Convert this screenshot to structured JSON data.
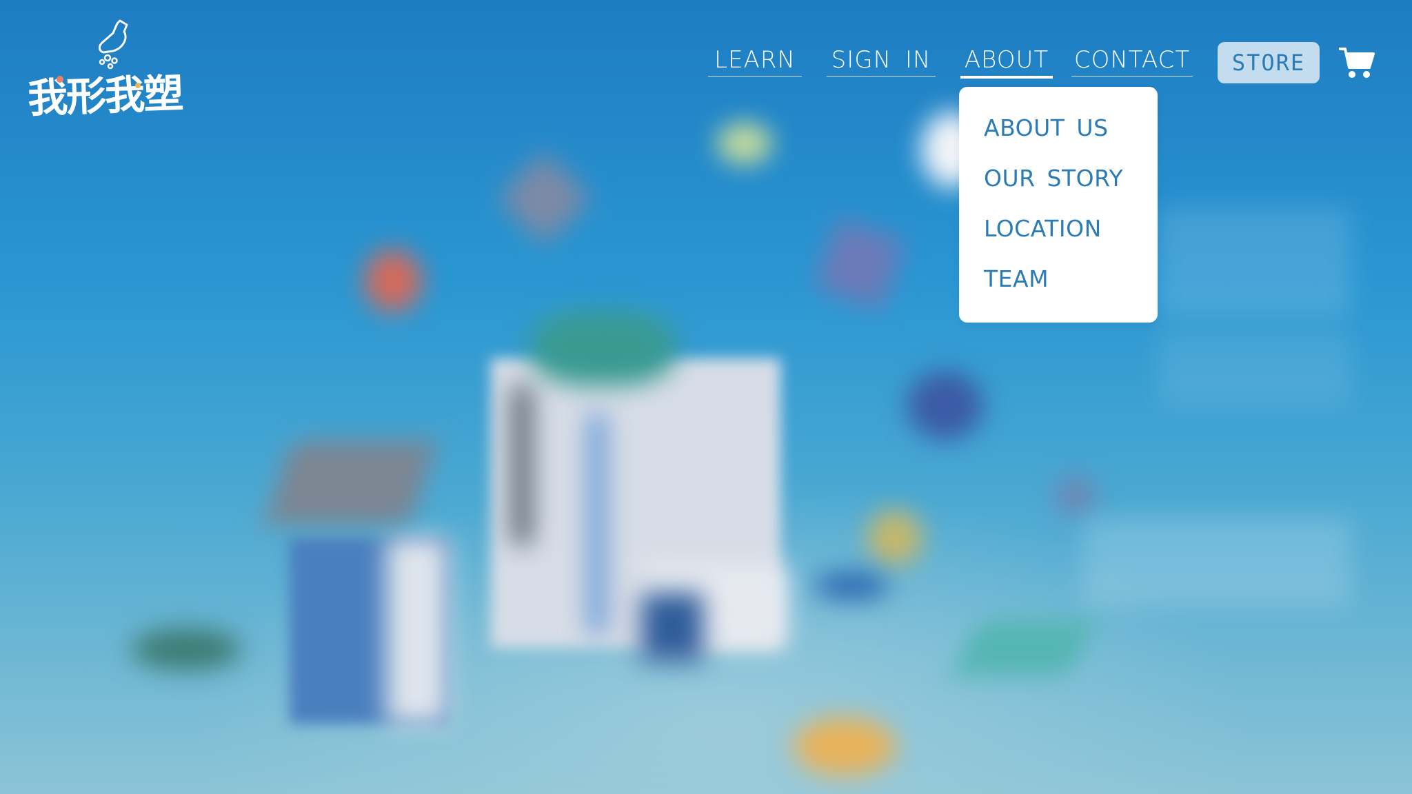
{
  "brand": {
    "name": "我形我塑"
  },
  "nav": {
    "items": [
      {
        "label": "LEARN"
      },
      {
        "label": "SIGN IN"
      },
      {
        "label": "ABOUT",
        "active": true
      },
      {
        "label": "CONTACT"
      }
    ],
    "store_label": "STORE",
    "cart_icon": "cart-icon"
  },
  "about_dropdown": {
    "items": [
      {
        "label": "ABOUT US"
      },
      {
        "label": "OUR STORY"
      },
      {
        "label": "LOCATION"
      },
      {
        "label": "TEAM"
      }
    ]
  },
  "colors": {
    "accent": "#2a7bb6",
    "store_bg": "#c3dcee",
    "background": "#2a8ac8"
  }
}
